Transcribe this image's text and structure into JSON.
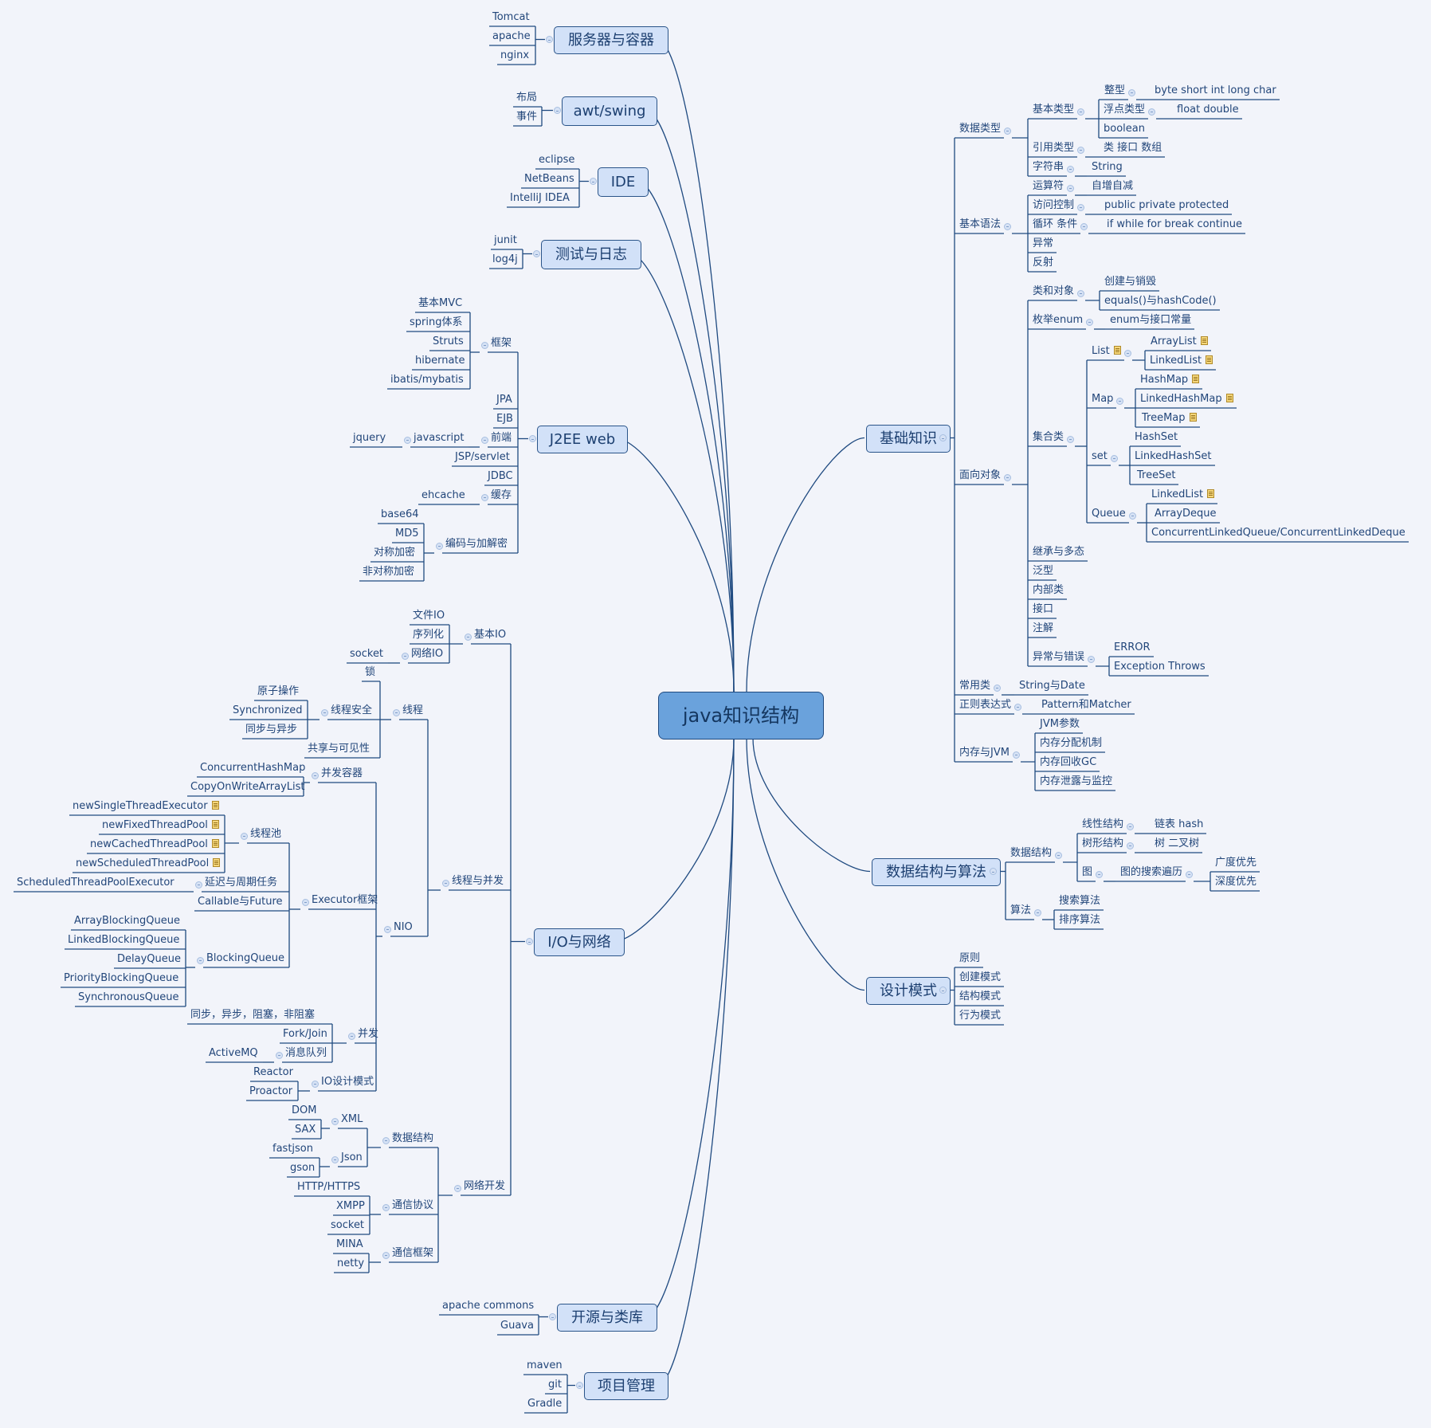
{
  "title": "java知识结构",
  "colors": {
    "line": "#1f4a80",
    "root_fill": "#6aa2dc",
    "main_fill": "#d2e1f8",
    "background": "#f2f4fa",
    "note": "#f5d77b"
  },
  "branches": [
    {
      "label": "服务器与容器",
      "side": "left",
      "children": [
        {
          "label": "Tomcat"
        },
        {
          "label": "apache"
        },
        {
          "label": "nginx"
        }
      ]
    },
    {
      "label": "awt/swing",
      "side": "left",
      "children": [
        {
          "label": "布局"
        },
        {
          "label": "事件"
        }
      ]
    },
    {
      "label": "IDE",
      "side": "left",
      "children": [
        {
          "label": "eclipse"
        },
        {
          "label": "NetBeans"
        },
        {
          "label": "IntelliJ IDEA"
        }
      ]
    },
    {
      "label": "测试与日志",
      "side": "left",
      "children": [
        {
          "label": "junit"
        },
        {
          "label": "log4j"
        }
      ]
    },
    {
      "label": "J2EE web",
      "side": "left",
      "children": [
        {
          "label": "框架",
          "children": [
            {
              "label": "基本MVC"
            },
            {
              "label": "spring体系"
            },
            {
              "label": "Struts"
            },
            {
              "label": "hibernate"
            },
            {
              "label": "ibatis/mybatis"
            }
          ]
        },
        {
          "label": "JPA"
        },
        {
          "label": "EJB"
        },
        {
          "label": "前端",
          "children": [
            {
              "label": "javascript",
              "children": [
                {
                  "label": "jquery"
                }
              ]
            }
          ]
        },
        {
          "label": "JSP/servlet"
        },
        {
          "label": "JDBC"
        },
        {
          "label": "缓存",
          "children": [
            {
              "label": "ehcache"
            }
          ]
        },
        {
          "label": "编码与加解密",
          "children": [
            {
              "label": "base64"
            },
            {
              "label": "MD5"
            },
            {
              "label": "对称加密"
            },
            {
              "label": "非对称加密"
            }
          ]
        }
      ]
    },
    {
      "label": "I/O与网络",
      "side": "left",
      "children": [
        {
          "label": "基本IO",
          "children": [
            {
              "label": "文件IO"
            },
            {
              "label": "序列化"
            },
            {
              "label": "网络IO",
              "children": [
                {
                  "label": "socket"
                }
              ]
            }
          ]
        },
        {
          "label": "线程与并发",
          "children": [
            {
              "label": "线程",
              "children": [
                {
                  "label": "锁"
                },
                {
                  "label": "线程安全",
                  "children": [
                    {
                      "label": "原子操作"
                    },
                    {
                      "label": "Synchronized"
                    },
                    {
                      "label": "同步与异步"
                    }
                  ]
                },
                {
                  "label": "共享与可见性"
                }
              ]
            },
            {
              "label": "NIO",
              "children": [
                {
                  "label": "并发容器",
                  "children": [
                    {
                      "label": "ConcurrentHashMap"
                    },
                    {
                      "label": "CopyOnWriteArrayList"
                    }
                  ]
                },
                {
                  "label": "Executor框架",
                  "children": [
                    {
                      "label": "线程池",
                      "children": [
                        {
                          "label": "newSingleThreadExecutor",
                          "note": true
                        },
                        {
                          "label": "newFixedThreadPool",
                          "note": true
                        },
                        {
                          "label": "newCachedThreadPool",
                          "note": true
                        },
                        {
                          "label": "newScheduledThreadPool",
                          "note": true
                        }
                      ]
                    },
                    {
                      "label": "延迟与周期任务",
                      "children": [
                        {
                          "label": "ScheduledThreadPoolExecutor"
                        }
                      ]
                    },
                    {
                      "label": "Callable与Future"
                    },
                    {
                      "label": "BlockingQueue",
                      "children": [
                        {
                          "label": "ArrayBlockingQueue"
                        },
                        {
                          "label": "LinkedBlockingQueue"
                        },
                        {
                          "label": "DelayQueue"
                        },
                        {
                          "label": "PriorityBlockingQueue"
                        },
                        {
                          "label": "SynchronousQueue"
                        }
                      ]
                    }
                  ]
                },
                {
                  "label": "并发",
                  "children": [
                    {
                      "label": "同步，异步，阻塞，非阻塞"
                    },
                    {
                      "label": "Fork/Join"
                    },
                    {
                      "label": "消息队列",
                      "children": [
                        {
                          "label": "ActiveMQ"
                        }
                      ]
                    }
                  ]
                },
                {
                  "label": "IO设计模式",
                  "children": [
                    {
                      "label": "Reactor"
                    },
                    {
                      "label": "Proactor"
                    }
                  ]
                }
              ]
            }
          ]
        },
        {
          "label": "网络开发",
          "children": [
            {
              "label": "数据结构",
              "children": [
                {
                  "label": "XML",
                  "children": [
                    {
                      "label": "DOM"
                    },
                    {
                      "label": "SAX"
                    }
                  ]
                },
                {
                  "label": "Json",
                  "children": [
                    {
                      "label": "fastjson"
                    },
                    {
                      "label": "gson"
                    }
                  ]
                }
              ]
            },
            {
              "label": "通信协议",
              "children": [
                {
                  "label": "HTTP/HTTPS"
                },
                {
                  "label": "XMPP"
                },
                {
                  "label": "socket"
                }
              ]
            },
            {
              "label": "通信框架",
              "children": [
                {
                  "label": "MINA"
                },
                {
                  "label": "netty"
                }
              ]
            }
          ]
        }
      ]
    },
    {
      "label": "开源与类库",
      "side": "left",
      "children": [
        {
          "label": "apache commons"
        },
        {
          "label": "Guava"
        }
      ]
    },
    {
      "label": "项目管理",
      "side": "left",
      "children": [
        {
          "label": "maven"
        },
        {
          "label": "git"
        },
        {
          "label": "Gradle"
        }
      ]
    },
    {
      "label": "基础知识",
      "side": "right",
      "children": [
        {
          "label": "数据类型",
          "children": [
            {
              "label": "基本类型",
              "children": [
                {
                  "label": "整型",
                  "children": [
                    {
                      "label": "byte short int long char"
                    }
                  ]
                },
                {
                  "label": "浮点类型",
                  "children": [
                    {
                      "label": "float  double"
                    }
                  ]
                },
                {
                  "label": "boolean"
                }
              ]
            },
            {
              "label": "引用类型",
              "children": [
                {
                  "label": "类 接口 数组"
                }
              ]
            },
            {
              "label": "字符串",
              "children": [
                {
                  "label": "String"
                }
              ]
            }
          ]
        },
        {
          "label": "基本语法",
          "children": [
            {
              "label": "运算符",
              "children": [
                {
                  "label": "自增自减"
                }
              ]
            },
            {
              "label": "访问控制",
              "children": [
                {
                  "label": "public private protected"
                }
              ]
            },
            {
              "label": "循环 条件",
              "children": [
                {
                  "label": "if while for break continue"
                }
              ]
            },
            {
              "label": "异常"
            },
            {
              "label": "反射"
            }
          ]
        },
        {
          "label": "面向对象",
          "children": [
            {
              "label": "类和对象",
              "children": [
                {
                  "label": "创建与销毁"
                },
                {
                  "label": "equals()与hashCode()"
                }
              ]
            },
            {
              "label": "枚举enum",
              "children": [
                {
                  "label": "enum与接口常量"
                }
              ]
            },
            {
              "label": "集合类",
              "children": [
                {
                  "label": "List",
                  "note": true,
                  "children": [
                    {
                      "label": "ArrayList",
                      "note": true
                    },
                    {
                      "label": "LinkedList",
                      "note": true
                    }
                  ]
                },
                {
                  "label": "Map",
                  "children": [
                    {
                      "label": "HashMap",
                      "note": true
                    },
                    {
                      "label": "LinkedHashMap",
                      "note": true
                    },
                    {
                      "label": "TreeMap",
                      "note": true
                    }
                  ]
                },
                {
                  "label": "set",
                  "children": [
                    {
                      "label": "HashSet"
                    },
                    {
                      "label": "LinkedHashSet"
                    },
                    {
                      "label": "TreeSet"
                    }
                  ]
                },
                {
                  "label": "Queue",
                  "children": [
                    {
                      "label": "LinkedList",
                      "note": true
                    },
                    {
                      "label": "ArrayDeque"
                    },
                    {
                      "label": "ConcurrentLinkedQueue/ConcurrentLinkedDeque"
                    }
                  ]
                }
              ]
            },
            {
              "label": "继承与多态"
            },
            {
              "label": "泛型"
            },
            {
              "label": "内部类"
            },
            {
              "label": "接口"
            },
            {
              "label": "注解"
            },
            {
              "label": "异常与错误",
              "children": [
                {
                  "label": "ERROR"
                },
                {
                  "label": "Exception Throws"
                }
              ]
            }
          ]
        },
        {
          "label": "常用类",
          "children": [
            {
              "label": "String与Date"
            }
          ]
        },
        {
          "label": "正则表达式",
          "children": [
            {
              "label": "Pattern和Matcher"
            }
          ]
        },
        {
          "label": "内存与JVM",
          "children": [
            {
              "label": "JVM参数"
            },
            {
              "label": "内存分配机制"
            },
            {
              "label": "内存回收GC"
            },
            {
              "label": "内存泄露与监控"
            }
          ]
        }
      ]
    },
    {
      "label": "数据结构与算法",
      "side": "right",
      "children": [
        {
          "label": "数据结构",
          "children": [
            {
              "label": "线性结构",
              "children": [
                {
                  "label": "链表 hash"
                }
              ]
            },
            {
              "label": "树形结构",
              "children": [
                {
                  "label": "树  二叉树"
                }
              ]
            },
            {
              "label": "图",
              "children": [
                {
                  "label": "图的搜索遍历",
                  "children": [
                    {
                      "label": "广度优先"
                    },
                    {
                      "label": "深度优先"
                    }
                  ]
                }
              ]
            }
          ]
        },
        {
          "label": "算法",
          "children": [
            {
              "label": "搜索算法"
            },
            {
              "label": "排序算法"
            }
          ]
        }
      ]
    },
    {
      "label": "设计模式",
      "side": "right",
      "children": [
        {
          "label": "原则"
        },
        {
          "label": "创建模式"
        },
        {
          "label": "结构模式"
        },
        {
          "label": "行为模式"
        }
      ]
    }
  ]
}
